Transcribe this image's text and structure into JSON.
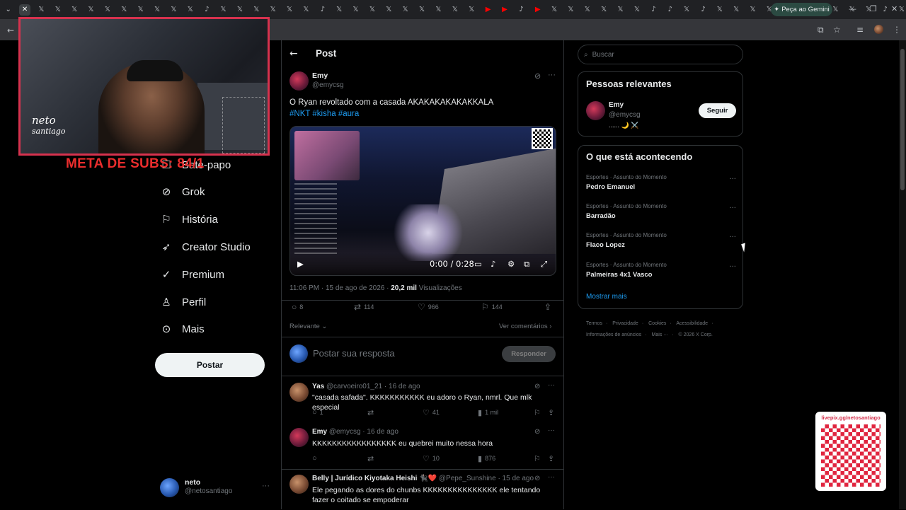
{
  "browser": {
    "tab_icons": [
      "chevron",
      "active",
      "x",
      "x",
      "x",
      "x",
      "x",
      "x",
      "x",
      "x",
      "x",
      "x",
      "tiktok",
      "x",
      "x",
      "x",
      "x",
      "x",
      "x",
      "tiktok",
      "x",
      "x",
      "x",
      "x",
      "x",
      "x",
      "x",
      "x",
      "x",
      "youtube",
      "youtube",
      "tiktok",
      "youtube",
      "x",
      "x",
      "x",
      "x",
      "x",
      "x",
      "tiktok",
      "tiktok",
      "x",
      "tiktok",
      "x",
      "x",
      "x",
      "x",
      "x",
      "x",
      "x",
      "x",
      "x",
      "x",
      "tiktok",
      "x",
      "x",
      "plus"
    ],
    "gemini_label": "Peça ao Gemini"
  },
  "stream_overlay": {
    "logo_line1": "neto",
    "logo_line2": "santiago",
    "meta_text": "META DE SUBS: 84/1",
    "qr_url": "livepix.gg/netosantiago"
  },
  "nav": {
    "items": [
      {
        "label": "Bate-papo",
        "icon": "chat-icon"
      },
      {
        "label": "Grok",
        "icon": "grok-icon"
      },
      {
        "label": "História",
        "icon": "bookmark-icon"
      },
      {
        "label": "Creator Studio",
        "icon": "rocket-icon"
      },
      {
        "label": "Premium",
        "icon": "verified-icon"
      },
      {
        "label": "Perfil",
        "icon": "person-icon"
      },
      {
        "label": "Mais",
        "icon": "more-circle-icon"
      }
    ],
    "post_button": "Postar",
    "account": {
      "name": "neto",
      "handle": "@netosantiago",
      "more": "···"
    }
  },
  "post": {
    "header_title": "Post",
    "author": {
      "name": "Emy",
      "handle": "@emycsg"
    },
    "text": "O Ryan revoltado com a casada AKAKAKAKAKAKKALA",
    "hashtags": "#NKT #kisha #aura",
    "video": {
      "time": "0:00 / 0:28"
    },
    "meta": {
      "time": "11:06 PM · 15 de ago de 2026 · ",
      "views": "20,2 mil",
      "views_label": " Visualizações"
    },
    "stats": {
      "replies": "8",
      "reposts": "114",
      "likes": "966",
      "bookmarks": "144"
    },
    "sort_label": "Relevante",
    "view_comments": "Ver comentários",
    "reply_placeholder": "Postar sua resposta",
    "reply_button": "Responder"
  },
  "replies": [
    {
      "name": "Yas",
      "handle": "@carvoeiro01_21",
      "date": "· 16 de ago",
      "text": "\"casada safada\". KKKKKKKKKKK eu adoro o Ryan, nmrl. Que mlk especial",
      "stats": {
        "replies": "1",
        "reposts": "",
        "likes": "41",
        "views": "1 mil"
      }
    },
    {
      "name": "Emy",
      "handle": "@emycsg",
      "date": "· 16 de ago",
      "text": "KKKKKKKKKKKKKKKKK eu quebrei muito nessa hora",
      "stats": {
        "replies": "",
        "reposts": "",
        "likes": "10",
        "views": "876"
      }
    },
    {
      "name": "Belly | Jurídico Kiyotaka Heishi 🐈‍⬛❤️",
      "handle": "@Pepe_Sunshine",
      "date": "· 15 de ago",
      "text": "Ele pegando as dores do chunbs KKKKKKKKKKKKKKK ele tentando fazer o coitado se empoderar"
    }
  ],
  "sidebar": {
    "search_placeholder": "Buscar",
    "relevant": {
      "title": "Pessoas relevantes",
      "name": "Emy",
      "handle": "@emycsg",
      "bio": "...... 🌙 ⚔️",
      "follow": "Seguir"
    },
    "trends": {
      "title": "O que está acontecendo",
      "items": [
        {
          "category": "Esportes · Assunto do Momento",
          "name": "Pedro Emanuel"
        },
        {
          "category": "Esportes · Assunto do Momento",
          "name": "Barradão"
        },
        {
          "category": "Esportes · Assunto do Momento",
          "name": "Flaco Lopez"
        },
        {
          "category": "Esportes · Assunto do Momento",
          "name": "Palmeiras 4x1 Vasco"
        }
      ],
      "show_more": "Mostrar mais"
    },
    "footer": {
      "line1": [
        "Termos",
        "Privacidade",
        "Cookies",
        "Acessibilidade"
      ],
      "line2": [
        "Informações de anúncios",
        "Mais ···",
        "© 2026 X Corp."
      ]
    }
  },
  "colors": {
    "accent": "#1d9bf0",
    "stream_red": "#ea2d2d",
    "background": "#000000"
  }
}
